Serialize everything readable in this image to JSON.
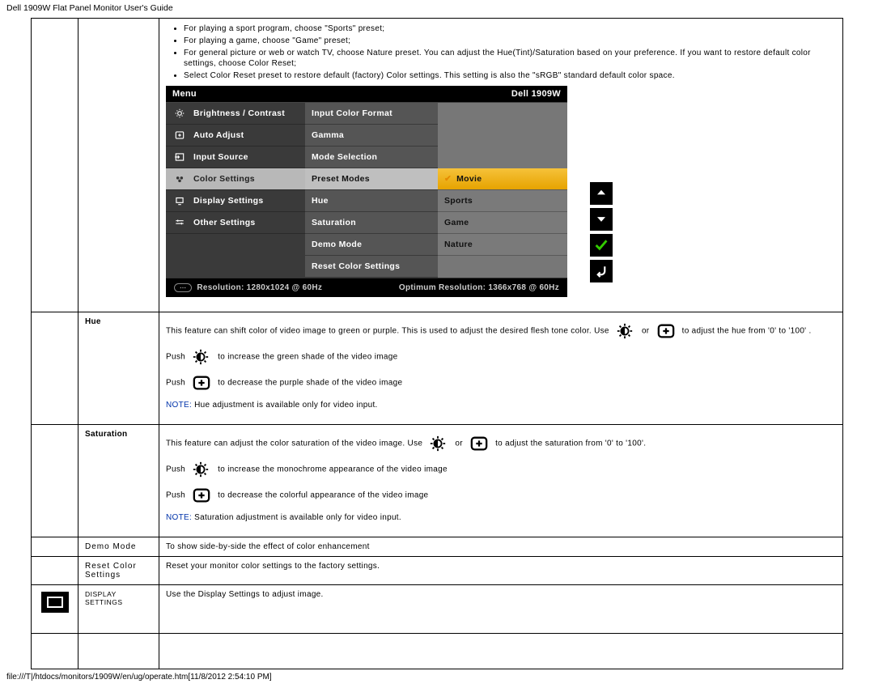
{
  "page_title": "Dell 1909W Flat Panel Monitor User's Guide",
  "footer_path": "file:///T|/htdocs/monitors/1909W/en/ug/operate.htm[11/8/2012 2:54:10 PM]",
  "top_bullets": [
    "For playing a sport program, choose \"Sports\" preset;",
    "For playing a game, choose \"Game\" preset;",
    "For general picture or web or watch TV, choose Nature preset. You can adjust the Hue(Tint)/Saturation based on your preference. If you want to restore default color settings, choose Color Reset;",
    "Select Color Reset preset to restore default (factory) Color settings. This setting is also the \"sRGB\" standard default color space."
  ],
  "osd": {
    "title_left": "Menu",
    "title_right": "Dell 1909W",
    "left_items": [
      "Brightness / Contrast",
      "Auto Adjust",
      "Input Source",
      "Color Settings",
      "Display Settings",
      "Other Settings"
    ],
    "left_selected_index": 3,
    "mid_items": [
      "Input Color Format",
      "Gamma",
      "Mode Selection",
      "Preset Modes",
      "Hue",
      "Saturation",
      "Demo Mode",
      "Reset Color Settings"
    ],
    "mid_selected_index": 3,
    "right_items": [
      "Movie",
      "Sports",
      "Game",
      "Nature"
    ],
    "right_selected_index": 0,
    "footer_left": "Resolution: 1280x1024 @ 60Hz",
    "footer_right": "Optimum Resolution: 1366x768 @ 60Hz"
  },
  "rows": {
    "hue": {
      "label": "Hue",
      "line1a": "This feature can shift color of video image to green or purple. This is used to adjust the desired flesh tone color. Use ",
      "line1b": " or ",
      "line1c": " to adjust the hue from '0' to '100' .",
      "push_a_pre": "Push ",
      "push_a_post": " to increase the green shade of the video image",
      "push_b_pre": "Push ",
      "push_b_post": "to decrease the purple shade of the video image",
      "note_prefix": "NOTE:",
      "note": " Hue adjustment is available only for video input."
    },
    "sat": {
      "label": "Saturation",
      "line1a": "This feature can adjust the color saturation of the video image. Use ",
      "line1b": " or ",
      "line1c": "to adjust the saturation from '0' to '100'.",
      "push_a_pre": "Push ",
      "push_a_post": " to increase the monochrome appearance of the video image",
      "push_b_pre": "Push ",
      "push_b_post": " to decrease the colorful appearance of the video image",
      "note_prefix": "NOTE:",
      "note": " Saturation adjustment is available only for video input."
    },
    "demo": {
      "label": "Demo  Mode",
      "desc": "To show side-by-side the effect of color enhancement"
    },
    "reset": {
      "label": "Reset  Color  Settings",
      "desc": "Reset your monitor color settings to the factory settings."
    },
    "display": {
      "label": "DISPLAY SETTINGS",
      "desc": "Use the Display Settings to adjust image."
    }
  }
}
